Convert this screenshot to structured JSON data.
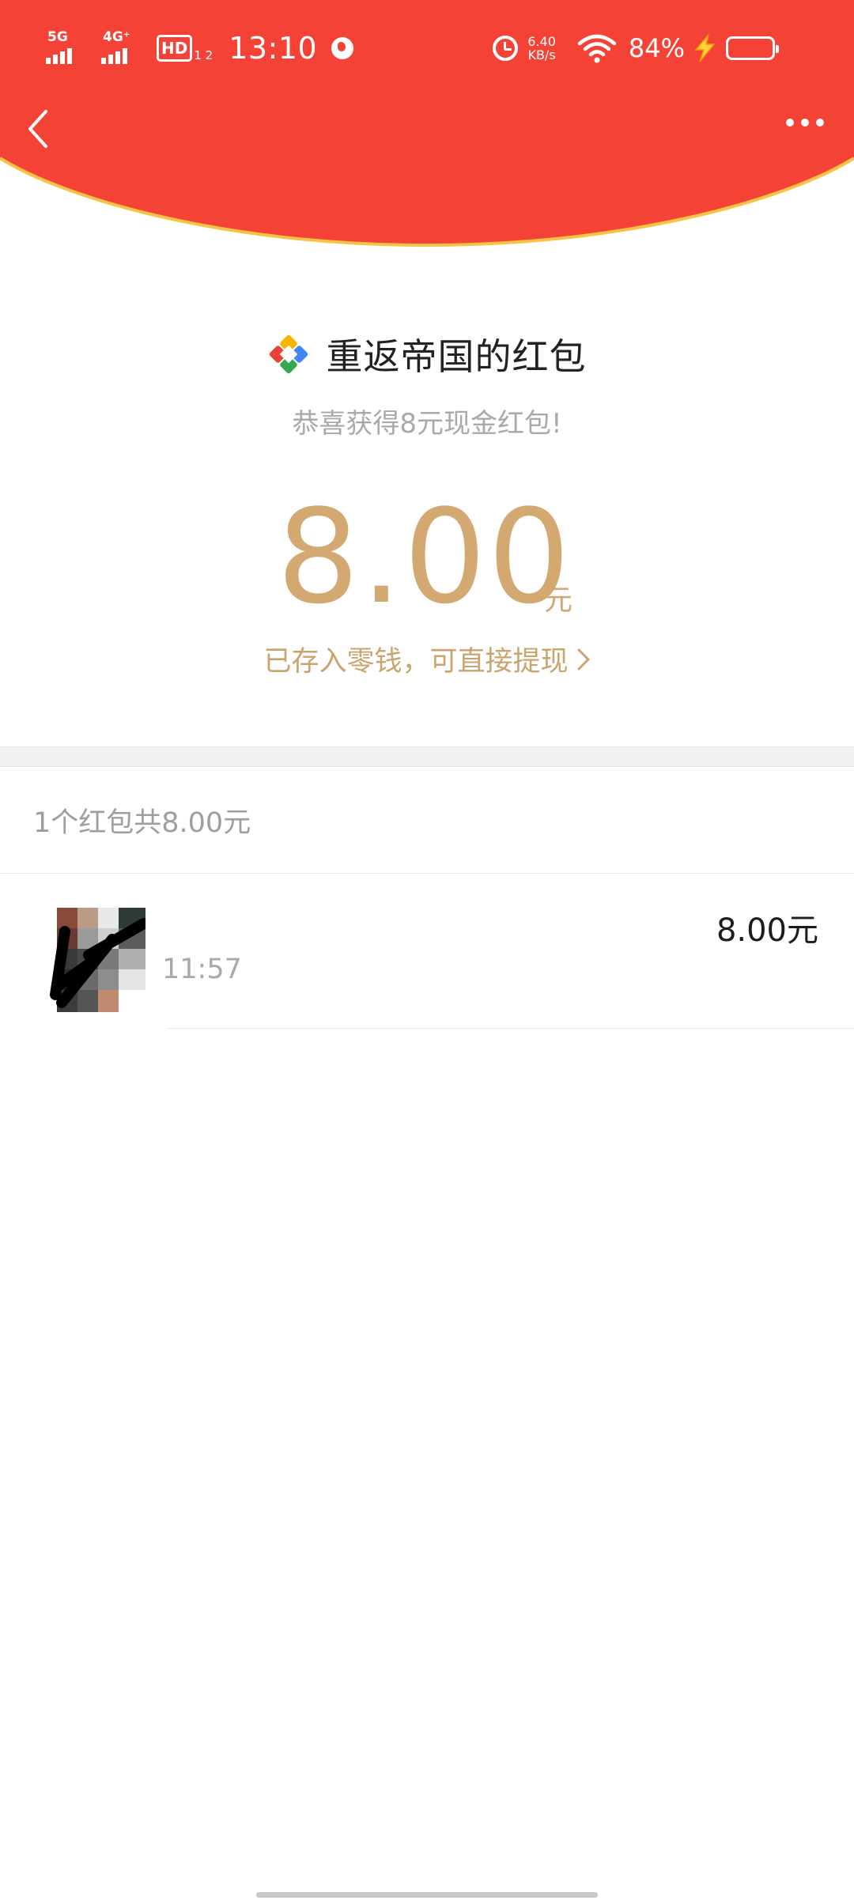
{
  "status_bar": {
    "sim1": "5G",
    "sim2": "4G⁺",
    "hd": "HD",
    "hd_num": "1 2",
    "time": "13:10",
    "speed_value": "6.40",
    "speed_unit": "KB/s",
    "battery": "84%"
  },
  "header": {
    "back_icon": "back-arrow-icon",
    "more_icon": "more-dots-icon",
    "bg_color": "#f44336"
  },
  "packet": {
    "sender_name": "重返帝国的红包",
    "subtitle": "恭喜获得8元现金红包!",
    "amount": "8.00",
    "unit": "元",
    "wallet_link": "已存入零钱，可直接提现",
    "accent_color": "#d4a971"
  },
  "list": {
    "summary": "1个红包共8.00元",
    "items": [
      {
        "time": "11:57",
        "amount": "8.00元"
      }
    ]
  }
}
